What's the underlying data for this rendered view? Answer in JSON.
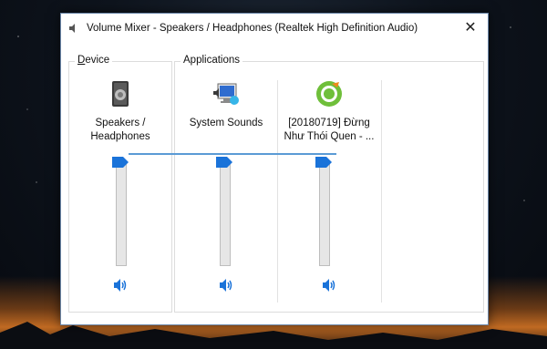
{
  "window": {
    "title": "Volume Mixer - Speakers / Headphones (Realtek High Definition Audio)",
    "close_glyph": "✕"
  },
  "device_group": {
    "label_accel": "D",
    "label_rest": "evice",
    "items": [
      {
        "label": "Speakers / Headphones",
        "icon": "speaker-icon",
        "volume": 1.0
      }
    ]
  },
  "applications_group": {
    "label": "Applications",
    "items": [
      {
        "label": "System Sounds",
        "icon": "system-sounds-icon",
        "volume": 1.0
      },
      {
        "label": "[20180719] Đừng Như Thói Quen - ...",
        "icon": "coccoc-icon",
        "volume": 1.0
      }
    ]
  },
  "colors": {
    "accent": "#1a73d9",
    "thumb": "#1a73d9"
  },
  "mute_icon": "speaker-volume-icon"
}
